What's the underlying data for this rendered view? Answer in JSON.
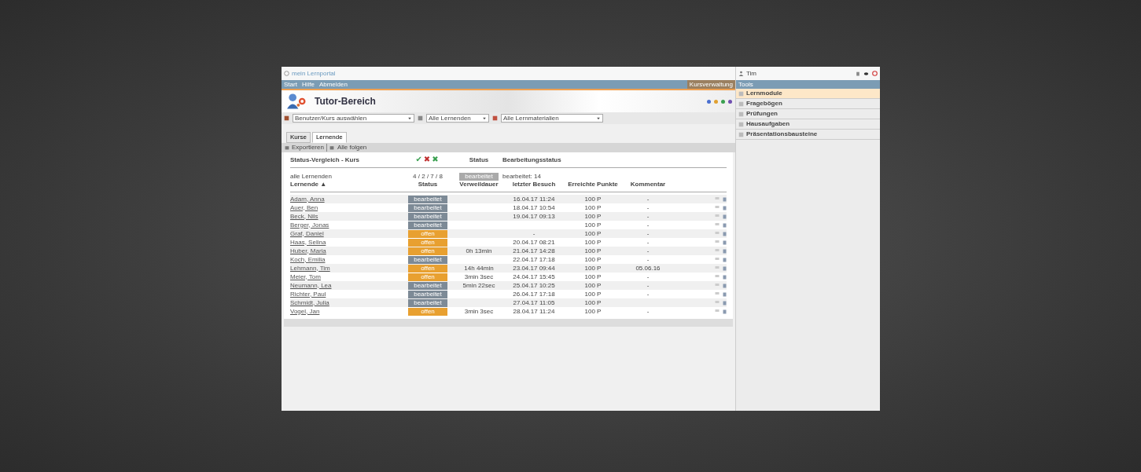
{
  "app": {
    "logo_text": "mein Lernportal",
    "user": "Tim",
    "menu": [
      "Start",
      "Hilfe",
      "Abmelden"
    ],
    "panel_button": "Kursverwaltung"
  },
  "header": {
    "title": "Tutor-Bereich",
    "color_dots": [
      {
        "color": "#4a6fd0"
      },
      {
        "color": "#e0a030"
      },
      {
        "color": "#3aa050"
      },
      {
        "color": "#7050b0"
      }
    ]
  },
  "filters": [
    {
      "kind": "course",
      "value": "Benutzer/Kurs auswählen"
    },
    {
      "kind": "group",
      "value": "Alle Lernenden"
    },
    {
      "kind": "material",
      "value": "Alle Lernmaterialien"
    }
  ],
  "tabs": [
    {
      "label": "Kurse",
      "selected": false
    },
    {
      "label": "Lernende",
      "selected": true
    }
  ],
  "toolbar": [
    "Exportieren",
    "Alle folgen"
  ],
  "summary": {
    "title": "Status-Vergleich - Kurs",
    "legend": [
      {
        "symbol": "✔",
        "color": "#3aa050"
      },
      {
        "symbol": "✖",
        "color": "#c03030"
      },
      {
        "symbol": "✖",
        "color": "#3aa050"
      }
    ],
    "status_heading": "Status",
    "progress_heading": "Bearbeitungsstatus",
    "all_label": "alle Lernenden",
    "counts": "4 / 2 / 7 / 8",
    "all_status": "bearbeitet",
    "progress": "bearbeitet: 14"
  },
  "table": {
    "columns": [
      "Lernende ▲",
      "Status",
      "Verweildauer",
      "letzter Besuch",
      "Erreichte Punkte",
      "Kommentar"
    ],
    "rows": [
      {
        "name": "Adam, Anna",
        "kind": "done",
        "status": "bearbeitet",
        "last_visit": "16.04.17 11:24",
        "points": "100 P",
        "comment": "-"
      },
      {
        "name": "Auer, Ben",
        "kind": "done",
        "status": "bearbeitet",
        "last_visit": "18.04.17 10:54",
        "points": "100 P",
        "comment": "-"
      },
      {
        "name": "Beck, Nils",
        "kind": "done",
        "status": "bearbeitet",
        "last_visit": "19.04.17 09:13",
        "points": "100 P",
        "comment": "-"
      },
      {
        "name": "Berger, Jonas",
        "kind": "done",
        "status": "bearbeitet",
        "points": "100 P",
        "comment": "-"
      },
      {
        "name": "Graf, Daniel",
        "kind": "open",
        "status": "offen",
        "last_visit": "-",
        "points": "100 P",
        "comment": "-"
      },
      {
        "name": "Haas, Selina",
        "kind": "open",
        "status": "offen",
        "last_visit": "20.04.17 08:21",
        "points": "100 P",
        "comment": "-"
      },
      {
        "name": "Huber, Maria",
        "kind": "open",
        "status": "offen",
        "duration": "0h 13min",
        "last_visit": "21.04.17 14:28",
        "points": "100 P",
        "comment": "-"
      },
      {
        "name": "Koch, Emilia",
        "kind": "done",
        "status": "bearbeitet",
        "last_visit": "22.04.17 17:18",
        "points": "100 P",
        "comment": "-"
      },
      {
        "name": "Lehmann, Tim",
        "kind": "open",
        "status": "offen",
        "duration": "14h 44min",
        "last_visit": "23.04.17 09:44",
        "points": "100 P",
        "comment": "05.06.16"
      },
      {
        "name": "Meier, Tom",
        "kind": "open",
        "status": "offen",
        "duration": "3min 3sec",
        "last_visit": "24.04.17 15:45",
        "points": "100 P",
        "comment": "-"
      },
      {
        "name": "Neumann, Lea",
        "kind": "done",
        "status": "bearbeitet",
        "duration": "5min 22sec",
        "last_visit": "25.04.17 10:25",
        "points": "100 P",
        "comment": "-"
      },
      {
        "name": "Richter, Paul",
        "kind": "done",
        "status": "bearbeitet",
        "last_visit": "26.04.17 17:18",
        "points": "100 P",
        "comment": "-"
      },
      {
        "name": "Schmidt, Julia",
        "kind": "done",
        "status": "bearbeitet",
        "last_visit": "27.04.17 11:05",
        "points": "100 P"
      },
      {
        "name": "Vogel, Jan",
        "kind": "open",
        "status": "offen",
        "duration": "3min 3sec",
        "last_visit": "28.04.17 11:24",
        "points": "100 P",
        "comment": "-"
      }
    ]
  },
  "sidebar": {
    "title": "Tools",
    "items": [
      {
        "label": "Lernmodule",
        "selected": true
      },
      {
        "label": "Fragebögen",
        "selected": false
      },
      {
        "label": "Prüfungen",
        "selected": false
      },
      {
        "label": "Hausaufgaben",
        "selected": false
      },
      {
        "label": "Präsentationsbausteine",
        "selected": false
      }
    ]
  }
}
